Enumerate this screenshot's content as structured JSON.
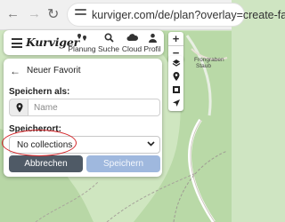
{
  "browser": {
    "url": "kurviger.com/de/plan?overlay=create-favo"
  },
  "app": {
    "logo": "Kurviger",
    "nav": [
      {
        "label": "Planung",
        "icon": "map-marker-pair-icon"
      },
      {
        "label": "Suche",
        "icon": "search-icon"
      },
      {
        "label": "Cloud",
        "icon": "cloud-icon"
      },
      {
        "label": "Profil",
        "icon": "user-icon"
      }
    ]
  },
  "controls": {
    "zoom_in": "+",
    "zoom_out": "−"
  },
  "dialog": {
    "title": "Neuer Favorit",
    "save_as_label": "Speichern als:",
    "name_placeholder": "Name",
    "location_label": "Speicherort:",
    "collection_selected": "No collections",
    "cancel_label": "Abbrechen",
    "save_label": "Speichern"
  },
  "map": {
    "labels": [
      "Frongraben",
      "Staub"
    ]
  },
  "colors": {
    "cancel_button": "#4f5a66",
    "save_button": "#9fb8de",
    "highlight_oval": "#d4282c",
    "map_forest": "#b5d6a4"
  }
}
